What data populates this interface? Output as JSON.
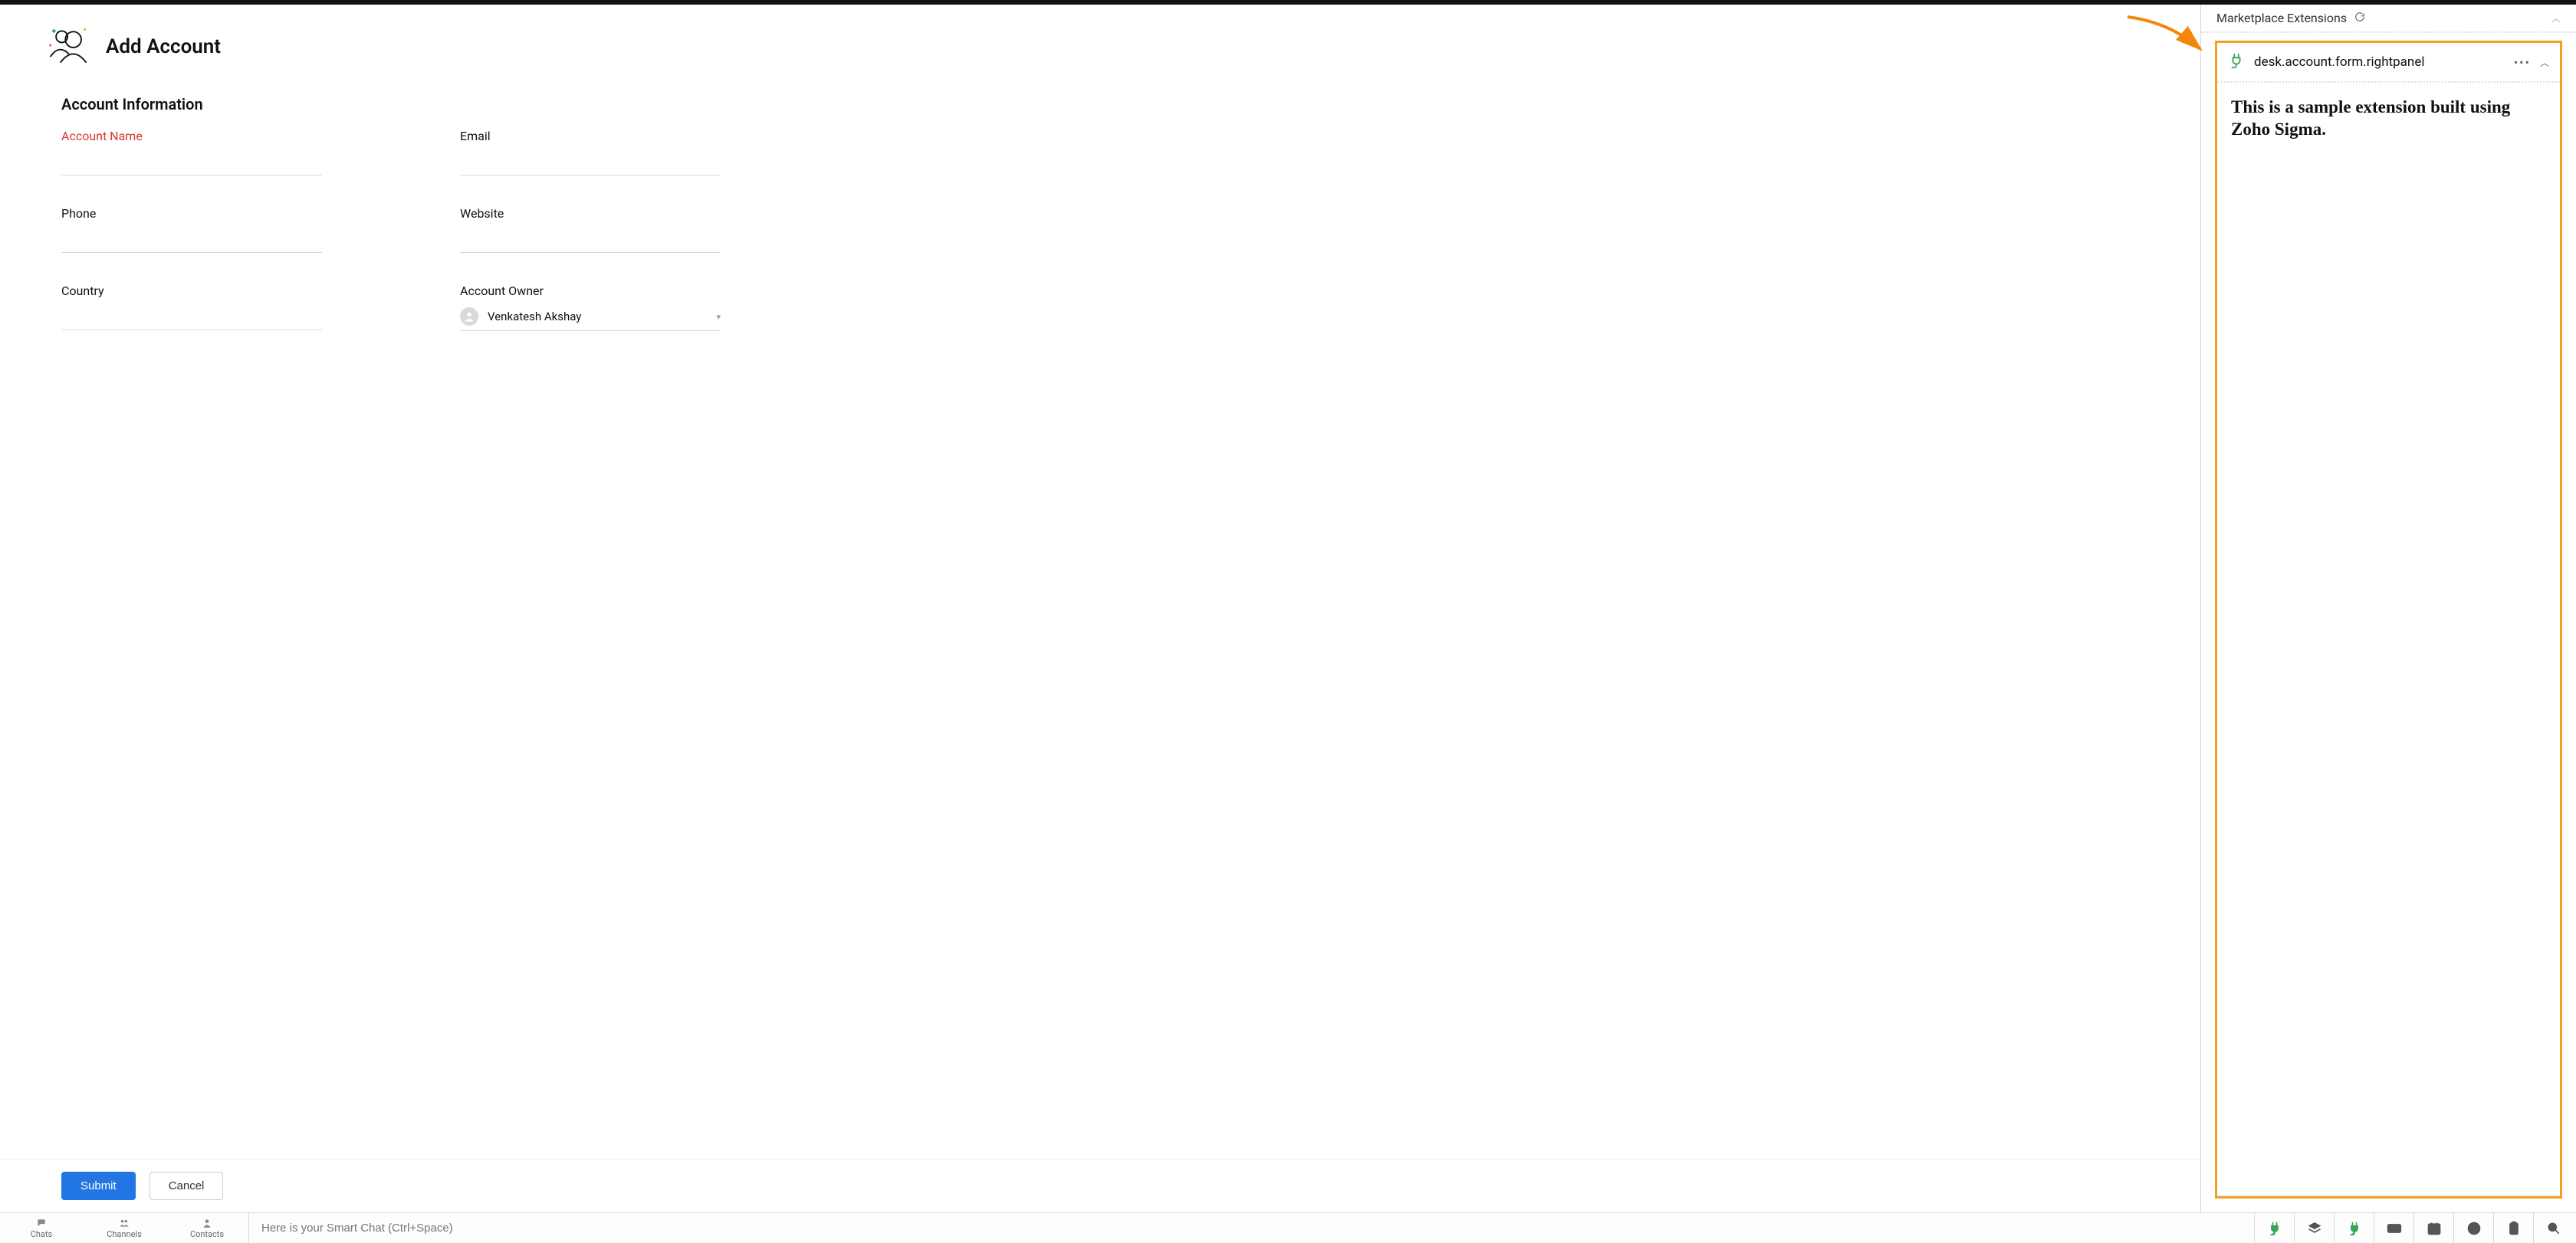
{
  "header": {
    "title": "Add Account"
  },
  "form": {
    "section_title": "Account Information",
    "fields": {
      "account_name": {
        "label": "Account Name",
        "value": ""
      },
      "email": {
        "label": "Email",
        "value": ""
      },
      "phone": {
        "label": "Phone",
        "value": ""
      },
      "website": {
        "label": "Website",
        "value": ""
      },
      "country": {
        "label": "Country",
        "value": ""
      },
      "account_owner": {
        "label": "Account Owner",
        "value": "Venkatesh Akshay"
      }
    }
  },
  "actions": {
    "submit": "Submit",
    "cancel": "Cancel"
  },
  "right_panel": {
    "header": "Marketplace Extensions",
    "extension": {
      "id": "desk.account.form.rightpanel",
      "body": "This is a sample extension built using Zoho Sigma."
    }
  },
  "bottom_bar": {
    "tabs": {
      "chats": "Chats",
      "channels": "Channels",
      "contacts": "Contacts"
    },
    "smart_chat_placeholder": "Here is your Smart Chat (Ctrl+Space)"
  },
  "colors": {
    "highlight": "#F2A01E",
    "primary": "#2276E3",
    "required": "#D9362B"
  }
}
